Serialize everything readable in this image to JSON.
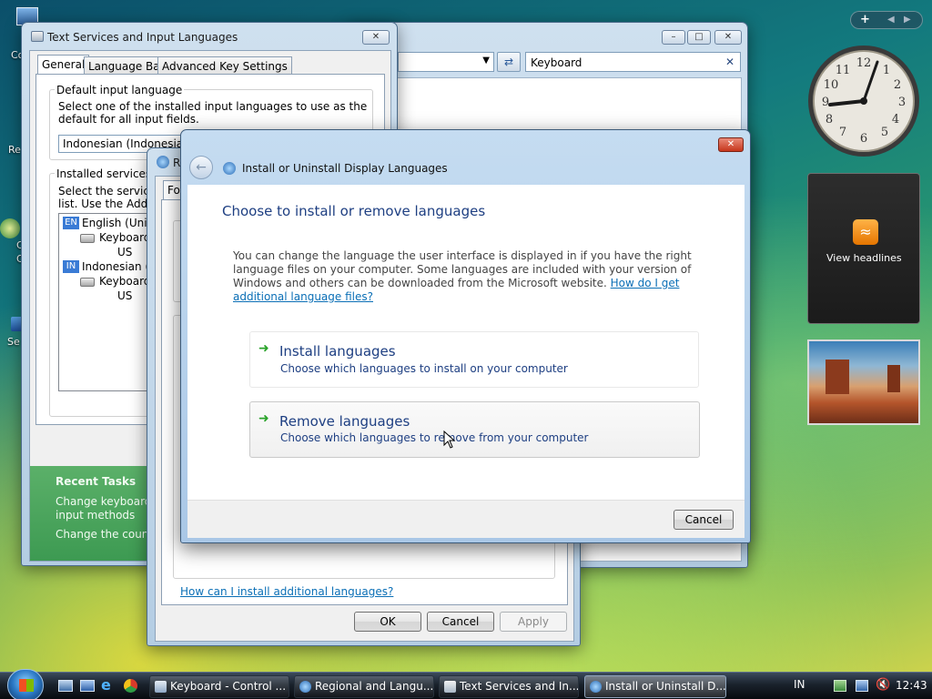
{
  "desktop": {
    "icon_labels": [
      "Co",
      "Re",
      "C",
      "C",
      "Se"
    ]
  },
  "control_panel_window": {
    "search_value": "Keyboard",
    "recent_tasks": {
      "title": "Recent Tasks",
      "item1_line1": "Change keyboards",
      "item1_line2": "input methods",
      "item2": "Change the country"
    }
  },
  "text_services_dialog": {
    "title": "Text Services and Input Languages",
    "tabs": [
      "General",
      "Language Bar",
      "Advanced Key Settings"
    ],
    "default_group_label": "Default input language",
    "default_desc": "Select one of the installed input languages to use as the default for all input fields.",
    "default_value": "Indonesian (Indonesia) - US",
    "installed_group_label": "Installed services",
    "installed_desc_1": "Select the services th",
    "installed_desc_2": "list. Use the Add and",
    "tree": [
      {
        "badge": "EN",
        "lang": "English (United",
        "kb": "Keyboard",
        "layout": "US"
      },
      {
        "badge": "IN",
        "lang": "Indonesian (Ind",
        "kb": "Keyboard",
        "layout": "US"
      }
    ]
  },
  "regional_dialog": {
    "title": "R",
    "tab_visible": "For",
    "link": "How can I install additional languages?",
    "ok": "OK",
    "cancel": "Cancel",
    "apply": "Apply"
  },
  "install_dialog": {
    "title": "Install or Uninstall Display Languages",
    "heading": "Choose to install or remove languages",
    "description": "You can change the language the user interface is displayed in if you have the right language files on your computer. Some languages are included with your version of Windows and others can be downloaded from the Microsoft website.",
    "help_link": "How do I get additional language files?",
    "option_install_title": "Install languages",
    "option_install_desc": "Choose which languages to install on your computer",
    "option_remove_title": "Remove languages",
    "option_remove_desc": "Choose which languages to remove from your computer",
    "cancel": "Cancel"
  },
  "sidebar": {
    "headlines": "View headlines"
  },
  "taskbar": {
    "tasks": [
      "Keyboard - Control ...",
      "Regional and Langu...",
      "Text Services and In...",
      "Install or Uninstall D..."
    ],
    "language_indicator": "IN",
    "clock": "12:43"
  },
  "colors": {
    "link": "#0b6fb6",
    "heading": "#1e3f82",
    "option_title": "#1e3f82",
    "arrow": "#2aa32a"
  }
}
